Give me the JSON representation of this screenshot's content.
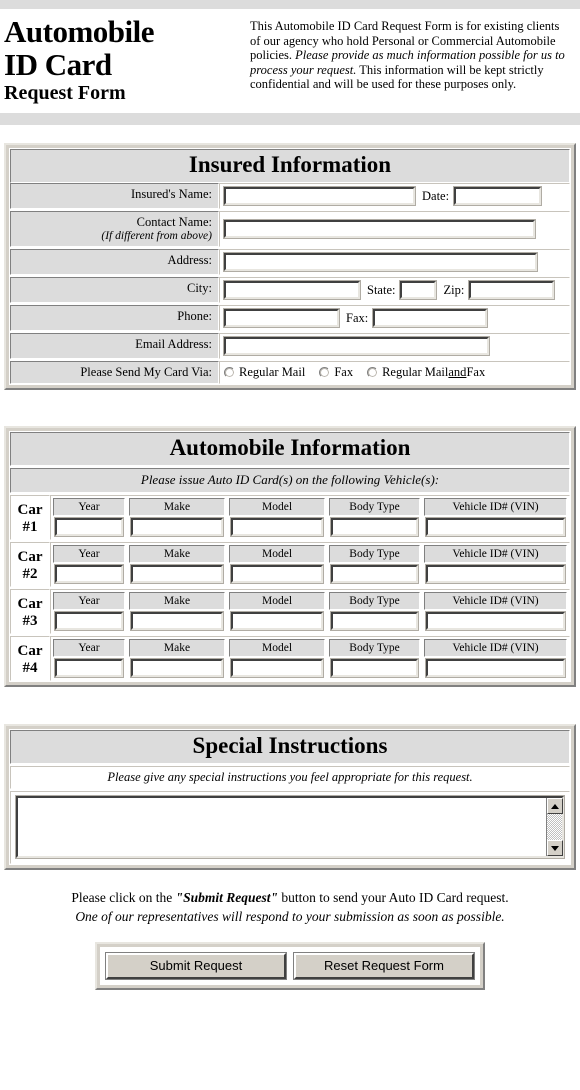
{
  "header": {
    "title_line1": "Automobile",
    "title_line2": "ID Card",
    "title_line3": "Request Form",
    "blurb_part1": "This Automobile ID Card Request Form is for existing clients of our agency who hold Personal or Commercial Automobile policies. ",
    "blurb_italic": "Please provide as much information possible for us to process your request.",
    "blurb_part2": " This information will be kept strictly confidential and will be used for these purposes only."
  },
  "insured": {
    "section_title": "Insured Information",
    "name_label": "Insured's Name:",
    "name_value": "",
    "date_label": "Date:",
    "date_value": "",
    "contact_label": "Contact Name:",
    "contact_sublabel": "(If different from above)",
    "contact_value": "",
    "address_label": "Address:",
    "address_value": "",
    "city_label": "City:",
    "city_value": "",
    "state_label": "State:",
    "state_value": "",
    "zip_label": "Zip:",
    "zip_value": "",
    "phone_label": "Phone:",
    "phone_value": "",
    "fax_label": "Fax:",
    "fax_value": "",
    "email_label": "Email Address:",
    "email_value": "",
    "send_via_label": "Please Send My Card Via:",
    "send_via_options": [
      {
        "label": "Regular Mail",
        "selected": false
      },
      {
        "label": "Fax",
        "selected": false
      },
      {
        "label_pre": "Regular Mail ",
        "label_underline": "and",
        "label_post": " Fax",
        "selected": false
      }
    ]
  },
  "automobile": {
    "section_title": "Automobile Information",
    "instruction": "Please issue Auto ID Card(s) on the following Vehicle(s):",
    "column_headers": [
      "Year",
      "Make",
      "Model",
      "Body Type",
      "Vehicle ID# (VIN)"
    ],
    "cars": [
      {
        "tag_line1": "Car",
        "tag_line2": "#1",
        "year": "",
        "make": "",
        "model": "",
        "body_type": "",
        "vin": ""
      },
      {
        "tag_line1": "Car",
        "tag_line2": "#2",
        "year": "",
        "make": "",
        "model": "",
        "body_type": "",
        "vin": ""
      },
      {
        "tag_line1": "Car",
        "tag_line2": "#3",
        "year": "",
        "make": "",
        "model": "",
        "body_type": "",
        "vin": ""
      },
      {
        "tag_line1": "Car",
        "tag_line2": "#4",
        "year": "",
        "make": "",
        "model": "",
        "body_type": "",
        "vin": ""
      }
    ]
  },
  "special": {
    "section_title": "Special Instructions",
    "instruction": "Please give any special instructions you feel appropriate for this request.",
    "textarea_value": "",
    "scroll_up_icon": "scroll-up-arrow-icon",
    "scroll_down_icon": "scroll-down-arrow-icon"
  },
  "footer": {
    "line1_pre": "Please click on the ",
    "line1_bold": "\"Submit Request\"",
    "line1_post": " button to send your Auto ID Card request.",
    "line2": "One of our representatives will respond to your submission as soon as possible.",
    "submit_label": "Submit Request",
    "reset_label": "Reset Request Form"
  },
  "colors": {
    "page_bg": "#ffffff",
    "band": "#dcdcdc",
    "section_face": "#d4d0c8",
    "cell_grey": "#dcdcdc",
    "shadow": "#808080",
    "highlight": "#ffffff"
  }
}
